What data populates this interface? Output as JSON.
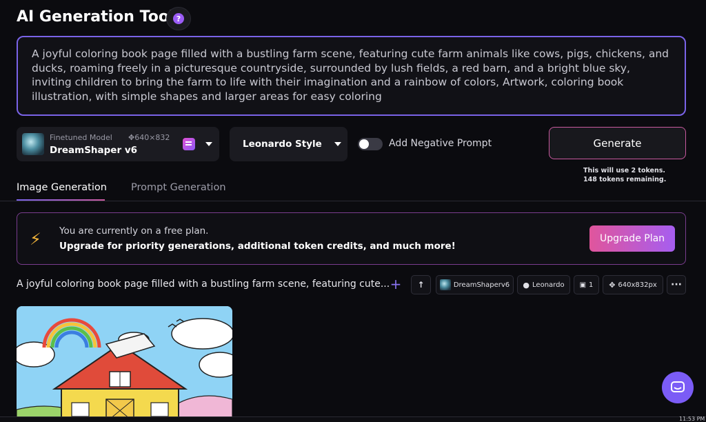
{
  "header": {
    "title": "AI Generation Tool",
    "help_icon": "question-icon",
    "help_glyph": "?"
  },
  "prompt": {
    "text": "A joyful coloring book page filled with a bustling farm scene, featuring cute farm animals like cows, pigs, chickens, and ducks, roaming freely in a picturesque countryside, surrounded by lush fields, a red barn, and a bright blue sky, inviting children to bring the farm to life with their imagination and a rainbow of colors, Artwork, coloring book illustration, with simple shapes and larger areas for easy coloring"
  },
  "controls": {
    "model": {
      "caption": "Finetuned Model",
      "dimensions": "640×832",
      "name": "DreamShaper v6"
    },
    "style": {
      "selected": "Leonardo Style"
    },
    "negative_prompt": {
      "label": "Add Negative Prompt",
      "enabled": false
    },
    "generate": {
      "label": "Generate",
      "token_cost": "This will use 2 tokens.",
      "tokens_remaining": "148 tokens remaining."
    }
  },
  "tabs": [
    {
      "label": "Image Generation",
      "active": true
    },
    {
      "label": "Prompt Generation",
      "active": false
    }
  ],
  "banner": {
    "line1": "You are currently on a free plan.",
    "line2": "Upgrade for priority generations, additional token credits, and much more!",
    "button": "Upgrade Plan",
    "icon": "lightning-icon"
  },
  "generation": {
    "prompt_preview": "A joyful coloring book page filled with a bustling farm scene, featuring cute...",
    "chips": {
      "model": "DreamShaperv6",
      "style": "Leonardo",
      "count": "1",
      "size": "640x832px",
      "more": "···"
    }
  },
  "taskbar": {
    "clock": "11:53 PM"
  },
  "colors": {
    "accent": "#7a63e8",
    "accent_pink": "#c95a9f",
    "background": "#0b0b0f"
  }
}
